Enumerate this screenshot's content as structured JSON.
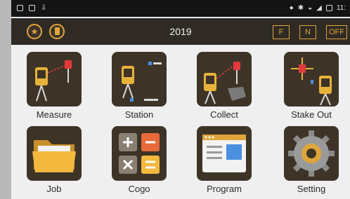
{
  "status_bar": {
    "time": "11:"
  },
  "header": {
    "title": "2019",
    "left_buttons": [
      {
        "icon": "star-icon"
      },
      {
        "icon": "battery-icon"
      }
    ],
    "right_buttons": [
      {
        "label": "F"
      },
      {
        "label": "N"
      },
      {
        "label": "OFF"
      }
    ]
  },
  "apps": [
    {
      "label": "Measure",
      "icon": "measure-icon"
    },
    {
      "label": "Station",
      "icon": "station-icon"
    },
    {
      "label": "Collect",
      "icon": "collect-icon"
    },
    {
      "label": "Stake Out",
      "icon": "stake-out-icon"
    },
    {
      "label": "Job",
      "icon": "folder-icon"
    },
    {
      "label": "Cogo",
      "icon": "calculator-icon"
    },
    {
      "label": "Program",
      "icon": "program-window-icon"
    },
    {
      "label": "Setting",
      "icon": "gear-icon"
    }
  ],
  "colors": {
    "accent": "#e0a53a",
    "tile": "#3d3427",
    "header": "#2f2a24",
    "screen": "#efefef"
  }
}
